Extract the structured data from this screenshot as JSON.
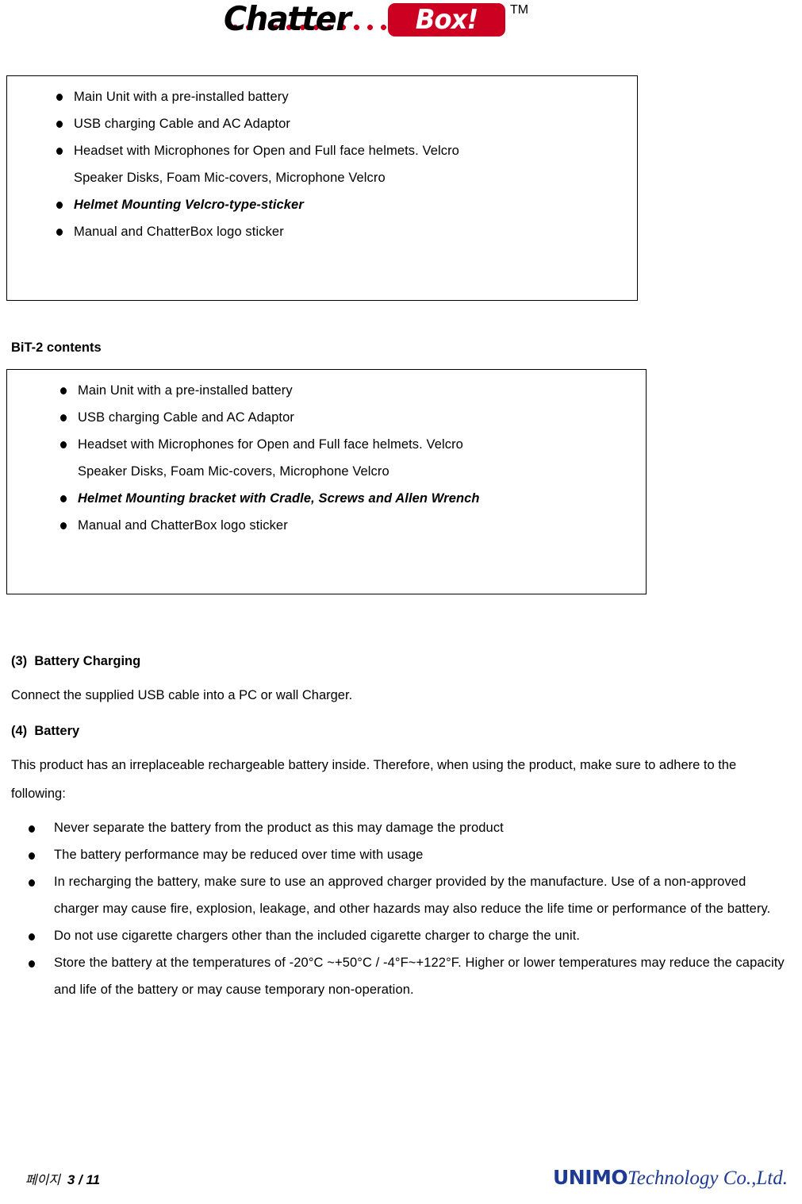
{
  "header": {
    "logo_chatter": "Chatter",
    "logo_box": "Box!",
    "trademark": "TM",
    "colors": {
      "logo_red": "#cc0020",
      "dot_red": "#d2001f",
      "brand_blue": "#1f3a93"
    }
  },
  "bit1_box": {
    "items": [
      {
        "text": "Main Unit with a pre-installed battery",
        "style": "normal",
        "cont": ""
      },
      {
        "text": "USB charging Cable and AC Adaptor",
        "style": "normal",
        "cont": ""
      },
      {
        "text": "Headset with Microphones for Open and Full face helmets. Velcro",
        "style": "normal",
        "cont": "Speaker Disks, Foam Mic-covers, Microphone Velcro"
      },
      {
        "text": "Helmet Mounting Velcro-type-sticker",
        "style": "bolditalic",
        "cont": ""
      },
      {
        "text": "Manual and ChatterBox logo sticker",
        "style": "normal",
        "cont": ""
      }
    ]
  },
  "bit2_heading": "BiT-2 contents",
  "bit2_box": {
    "items": [
      {
        "text": "Main Unit with a pre-installed battery",
        "style": "normal",
        "cont": ""
      },
      {
        "text": "USB charging Cable and AC Adaptor",
        "style": "normal",
        "cont": ""
      },
      {
        "text": "Headset with Microphones for Open and Full face helmets. Velcro",
        "style": "normal",
        "cont": "Speaker Disks, Foam Mic-covers, Microphone Velcro"
      },
      {
        "text": "Helmet Mounting bracket with Cradle, Screws and Allen Wrench",
        "style": "bolditalic",
        "cont": ""
      },
      {
        "text": "Manual and ChatterBox logo sticker",
        "style": "normal",
        "cont": ""
      }
    ]
  },
  "section3": {
    "heading": "(3)  Battery Charging",
    "body": "Connect the supplied USB cable into a PC or wall Charger."
  },
  "section4": {
    "heading": "(4)  Battery",
    "body": "This product has an irreplaceable rechargeable battery inside. Therefore, when using the product, make sure to adhere to the following:",
    "items": [
      {
        "text": "Never separate the battery from the product as this may damage the product",
        "cont": ""
      },
      {
        "text": "The battery performance may be reduced over time with usage",
        "cont": ""
      },
      {
        "text": "In recharging the battery, make sure to use an approved charger provided by the manufacture. Use of a non-approved charger may cause fire, explosion, leakage, and other hazards may also reduce the life time or performance of the battery.",
        "cont": ""
      },
      {
        "text": "Do not use cigarette chargers other than the included cigarette charger to charge the unit.",
        "cont": ""
      },
      {
        "text": "Store the battery at the temperatures of -20°C ~+50°C / -4°F~+122°F. Higher or lower temperatures may reduce the capacity and life of the battery or may cause temporary non-operation.",
        "cont": ""
      }
    ]
  },
  "footer": {
    "page_label": "페이지",
    "page_number": "3 / 11",
    "brand_bold": "UNIMO",
    "brand_rest": "Technology Co.,Ltd."
  }
}
